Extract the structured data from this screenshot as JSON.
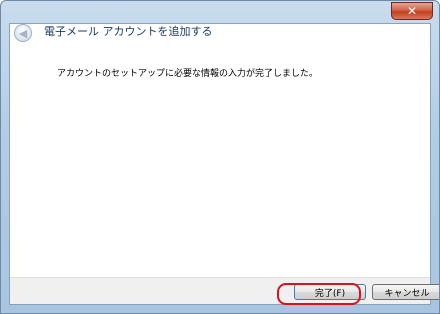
{
  "window": {
    "close_glyph": "✕",
    "back_icon": "arrow-left-icon"
  },
  "wizard": {
    "title": "電子メール アカウントを追加する",
    "message": "アカウントのセットアップに必要な情報の入力が完了しました。"
  },
  "footer": {
    "finish_label": "完了(F)",
    "cancel_label": "キャンセル"
  },
  "colors": {
    "title_text": "#1c3a63",
    "highlight": "#d8131c",
    "close_button": "#c2401f"
  }
}
